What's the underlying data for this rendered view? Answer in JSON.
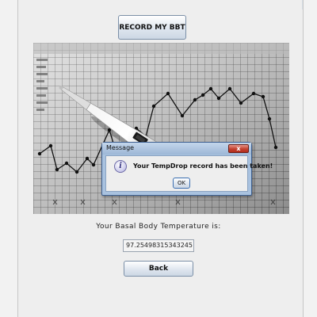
{
  "main": {
    "record_button_label": "RECORD MY BBT",
    "temperature_label": "Your Basal Body Temperature is:",
    "temperature_value": "97.25498315343245",
    "back_button_label": "Back"
  },
  "dialog": {
    "title": "Message",
    "message": "Your TempDrop record has been taken!",
    "ok_label": "OK",
    "close_glyph": "x",
    "info_glyph": "i"
  },
  "colors": {
    "dialog_frame": "#a9c2df",
    "close_button": "#c4412f",
    "button_gradient_bottom": "#ccd7e4"
  }
}
